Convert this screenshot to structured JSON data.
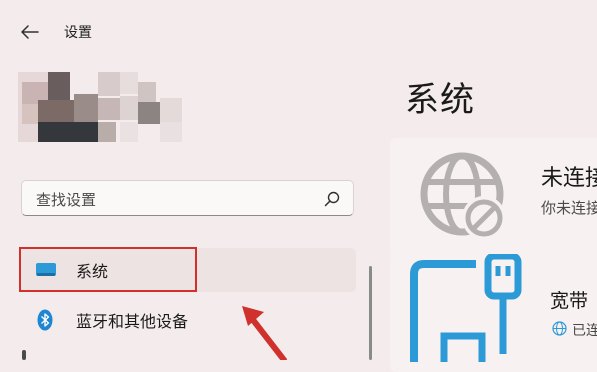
{
  "window": {
    "title": "设置"
  },
  "search": {
    "placeholder": "查找设置"
  },
  "sidebar": {
    "items": [
      {
        "label": "系统",
        "icon": "display-icon",
        "selected": true
      },
      {
        "label": "蓝牙和其他设备",
        "icon": "bluetooth-icon",
        "selected": false
      }
    ]
  },
  "main": {
    "title": "系统",
    "network_status": {
      "title": "未连接",
      "subtitle": "你未连接"
    },
    "broadband": {
      "title": "宽带",
      "status": "已连"
    }
  },
  "colors": {
    "background": "#f4ecec",
    "accent": "#2c9ad6",
    "highlight": "#d0312d",
    "icon_gray": "#b5b0b0"
  }
}
